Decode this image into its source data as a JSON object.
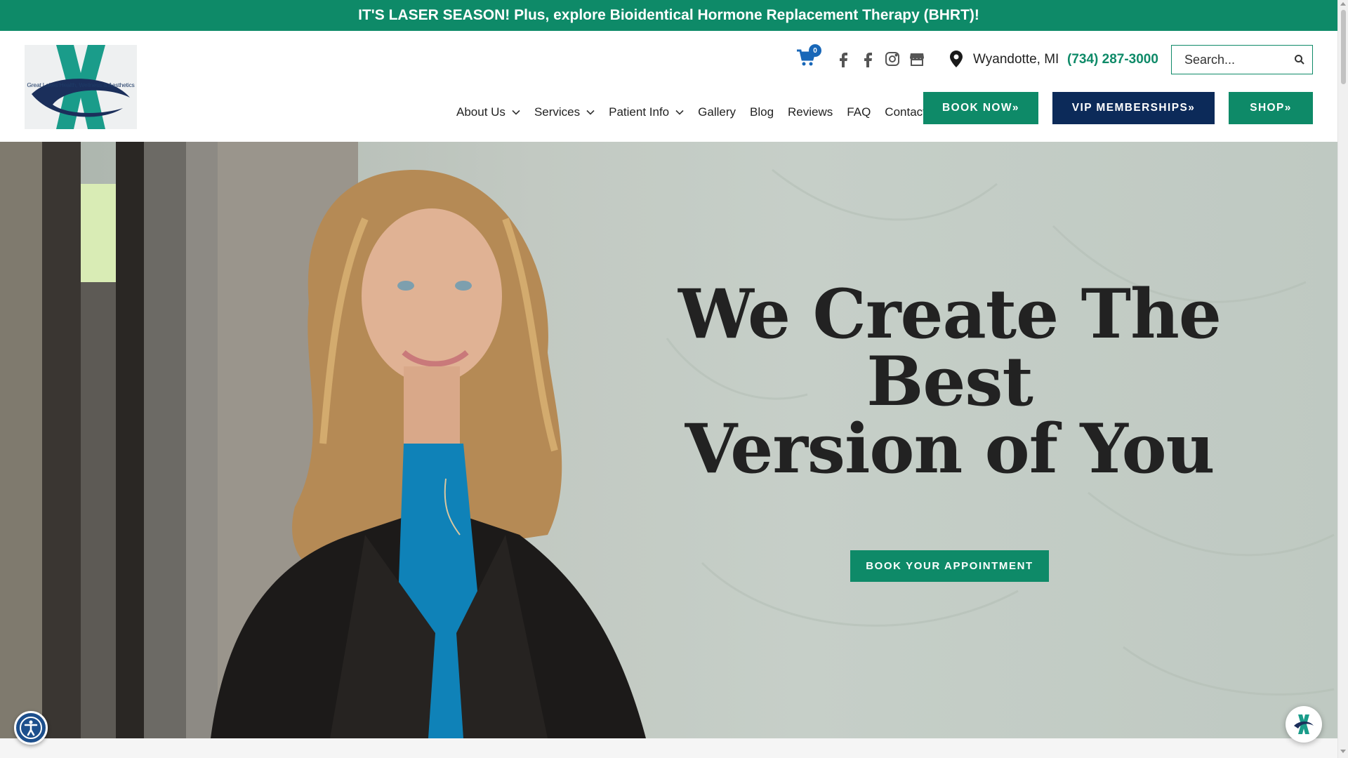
{
  "announcement": {
    "text": "IT'S LASER SEASON! Plus, explore Bioidentical Hormone Replacement Therapy (BHRT)!"
  },
  "logo": {
    "text": "Great Lakes Health, Wellness & Aesthetics",
    "colors": {
      "teal": "#1a9c8a",
      "navy": "#1b2f5b"
    }
  },
  "header": {
    "cart": {
      "count": "0",
      "icon": "cart-icon"
    },
    "social": [
      {
        "icon": "facebook-icon"
      },
      {
        "icon": "facebook-icon"
      },
      {
        "icon": "instagram-icon"
      },
      {
        "icon": "google-business-icon"
      }
    ],
    "location": {
      "icon": "map-pin-icon",
      "text": "Wyandotte, MI"
    },
    "phone": "(734) 287-3000",
    "search": {
      "placeholder": "Search...",
      "value": ""
    }
  },
  "nav": {
    "items": [
      {
        "label": "About Us",
        "dropdown": true
      },
      {
        "label": "Services",
        "dropdown": true
      },
      {
        "label": "Patient Info",
        "dropdown": true
      },
      {
        "label": "Gallery",
        "dropdown": false
      },
      {
        "label": "Blog",
        "dropdown": false
      },
      {
        "label": "Reviews",
        "dropdown": false
      },
      {
        "label": "FAQ",
        "dropdown": false
      },
      {
        "label": "Contact",
        "dropdown": false
      }
    ]
  },
  "buttons": {
    "book_now": "BOOK NOW»",
    "vip": "VIP MEMBERSHIPS»",
    "shop": "SHOP»"
  },
  "hero": {
    "title_line1": "We Create The Best",
    "title_line2": "Version of You",
    "cta": "BOOK YOUR APPOINTMENT"
  },
  "colors": {
    "brand_green": "#0e8a68",
    "brand_navy": "#0c2a59",
    "cart_blue": "#1867b8"
  }
}
